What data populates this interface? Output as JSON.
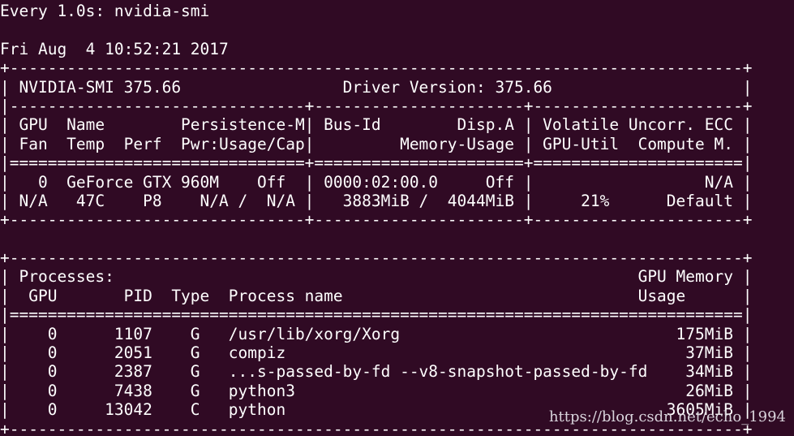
{
  "terminal": {
    "header": {
      "watch_line": "Every 1.0s: nvidia-smi",
      "blank": "",
      "timestamp": "Fri Aug  4 10:52:21 2017"
    },
    "gpu_table": [
      "+-----------------------------------------------------------------------------+",
      "| NVIDIA-SMI 375.66                 Driver Version: 375.66                    |",
      "|-------------------------------+----------------------+----------------------+",
      "| GPU  Name        Persistence-M| Bus-Id        Disp.A | Volatile Uncorr. ECC |",
      "| Fan  Temp  Perf  Pwr:Usage/Cap|         Memory-Usage | GPU-Util  Compute M. |",
      "|===============================+======================+======================|",
      "|   0  GeForce GTX 960M    Off  | 0000:02:00.0     Off |                  N/A |",
      "| N/A   47C    P8    N/A /  N/A |   3883MiB /  4044MiB |     21%      Default |",
      "+-------------------------------+----------------------+----------------------+"
    ],
    "blank2": "",
    "process_table": [
      "+-----------------------------------------------------------------------------+",
      "| Processes:                                                       GPU Memory |",
      "|  GPU       PID  Type  Process name                               Usage      |",
      "|=============================================================================|",
      "|    0      1107    G   /usr/lib/xorg/Xorg                             175MiB |",
      "|    0      2051    G   compiz                                          37MiB |",
      "|    0      2387    G   ...s-passed-by-fd --v8-snapshot-passed-by-fd    34MiB |",
      "|    0      7438    G   python3                                         26MiB |",
      "|    0     13042    C   python                                        3605MiB |",
      "+-----------------------------------------------------------------------------+"
    ],
    "watermark": "https://blog.csdn.net/echo_1994"
  }
}
